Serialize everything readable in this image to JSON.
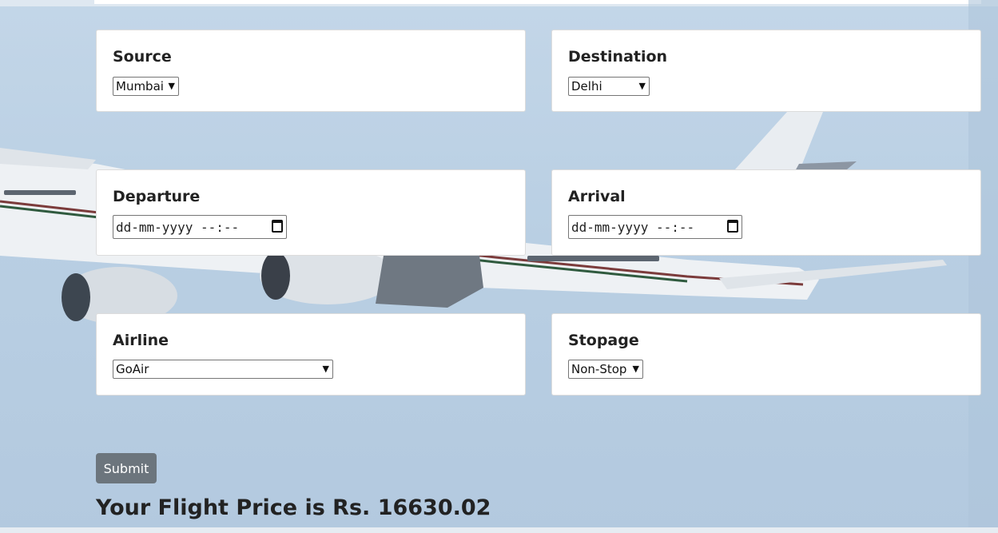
{
  "form": {
    "source": {
      "label": "Source",
      "selected": "Mumbai"
    },
    "destination": {
      "label": "Destination",
      "selected": "Delhi"
    },
    "departure": {
      "label": "Departure",
      "placeholder": "dd-mm-yyyy --:--"
    },
    "arrival": {
      "label": "Arrival",
      "placeholder": "dd-mm-yyyy --:--"
    },
    "airline": {
      "label": "Airline",
      "selected": "GoAir"
    },
    "stopage": {
      "label": "Stopage",
      "selected": "Non-Stop"
    },
    "submit_label": "Submit"
  },
  "result": {
    "text": "Your Flight Price is Rs. 16630.02"
  },
  "icons": {
    "dropdown": "chevron-down-icon",
    "calendar": "calendar-icon"
  },
  "colors": {
    "submit_bg": "#6c757d",
    "background": "#b9cfe3"
  }
}
